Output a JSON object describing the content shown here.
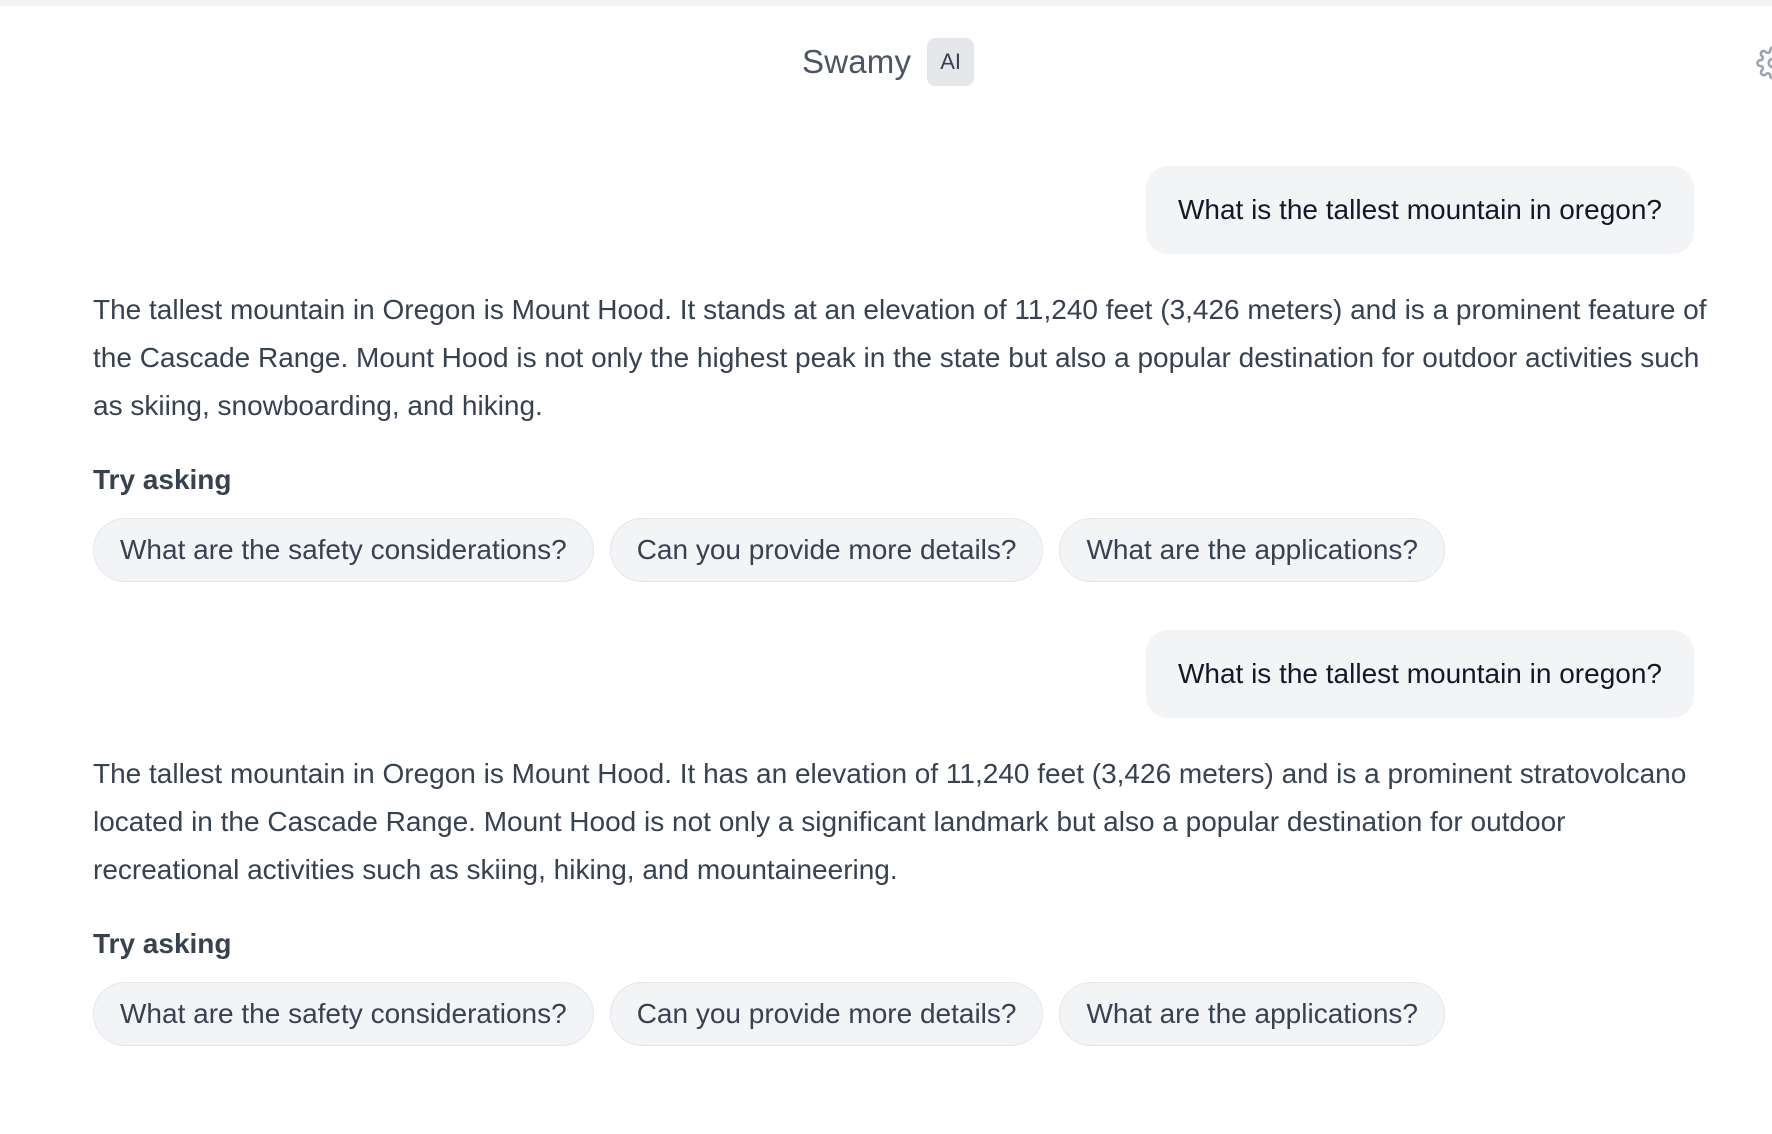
{
  "header": {
    "app_name": "Swamy",
    "badge": "AI",
    "settings_icon": "gear-icon"
  },
  "conversation": [
    {
      "question": "What is the tallest mountain in oregon?",
      "answer": "The tallest mountain in Oregon is Mount Hood. It stands at an elevation of 11,240 feet (3,426 meters) and is a prominent feature of the Cascade Range. Mount Hood is not only the highest peak in the state but also a popular destination for outdoor activities such as skiing, snowboarding, and hiking.",
      "suggestions_title": "Try asking",
      "suggestions": [
        "What are the safety considerations?",
        "Can you provide more details?",
        "What are the applications?"
      ]
    },
    {
      "question": "What is the tallest mountain in oregon?",
      "answer": "The tallest mountain in Oregon is Mount Hood. It has an elevation of 11,240 feet (3,426 meters) and is a prominent stratovolcano located in the Cascade Range. Mount Hood is not only a significant landmark but also a popular destination for outdoor recreational activities such as skiing, hiking, and mountaineering.",
      "suggestions_title": "Try asking",
      "suggestions": [
        "What are the safety considerations?",
        "Can you provide more details?",
        "What are the applications?"
      ]
    }
  ]
}
